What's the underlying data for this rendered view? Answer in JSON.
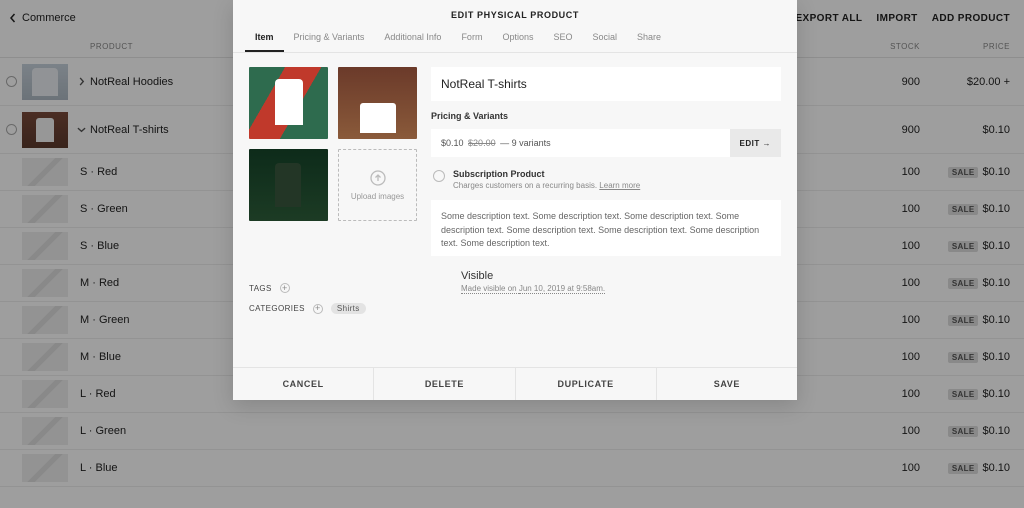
{
  "header": {
    "back_label": "Commerce",
    "actions": {
      "export": "EXPORT ALL",
      "import": "IMPORT",
      "add": "ADD PRODUCT"
    }
  },
  "list": {
    "columns": {
      "product": "PRODUCT",
      "stock": "STOCK",
      "price": "PRICE"
    },
    "products": [
      {
        "name": "NotReal Hoodies",
        "stock": "900",
        "price": "$20.00",
        "expanded": false,
        "note": "+"
      },
      {
        "name": "NotReal T-shirts",
        "stock": "900",
        "price": "$0.10",
        "expanded": true
      }
    ],
    "variants": [
      {
        "name": "S  ·  Red",
        "stock": "100",
        "price": "$0.10",
        "sale": "SALE"
      },
      {
        "name": "S  ·  Green",
        "stock": "100",
        "price": "$0.10",
        "sale": "SALE"
      },
      {
        "name": "S  ·  Blue",
        "stock": "100",
        "price": "$0.10",
        "sale": "SALE"
      },
      {
        "name": "M  ·  Red",
        "stock": "100",
        "price": "$0.10",
        "sale": "SALE"
      },
      {
        "name": "M  ·  Green",
        "stock": "100",
        "price": "$0.10",
        "sale": "SALE"
      },
      {
        "name": "M  ·  Blue",
        "stock": "100",
        "price": "$0.10",
        "sale": "SALE"
      },
      {
        "name": "L  ·  Red",
        "stock": "100",
        "price": "$0.10",
        "sale": "SALE"
      },
      {
        "name": "L  ·  Green",
        "stock": "100",
        "price": "$0.10",
        "sale": "SALE"
      },
      {
        "name": "L  ·  Blue",
        "stock": "100",
        "price": "$0.10",
        "sale": "SALE"
      }
    ]
  },
  "modal": {
    "title": "EDIT PHYSICAL PRODUCT",
    "tabs": [
      "Item",
      "Pricing & Variants",
      "Additional Info",
      "Form",
      "Options",
      "SEO",
      "Social",
      "Share"
    ],
    "active_tab": 0,
    "product_name": "NotReal T-shirts",
    "pv_label": "Pricing & Variants",
    "pv_price": "$0.10",
    "pv_original": "$20.00",
    "pv_variants": "— 9 variants",
    "pv_edit": "EDIT →",
    "sub_title": "Subscription Product",
    "sub_desc": "Charges customers on a recurring basis.",
    "sub_learn": "Learn more",
    "description": "Some description text. Some description text. Some description text. Some description text. Some description text. Some description text. Some description text. Some description text.",
    "upload_label": "Upload images",
    "tags_label": "TAGS",
    "categories_label": "CATEGORIES",
    "category_value": "Shirts",
    "visible_label": "Visible",
    "visible_when_prefix": "Made visible on ",
    "visible_when": "Jun 10, 2019 at 9:58am.",
    "footer": {
      "cancel": "CANCEL",
      "delete": "DELETE",
      "duplicate": "DUPLICATE",
      "save": "SAVE"
    }
  }
}
